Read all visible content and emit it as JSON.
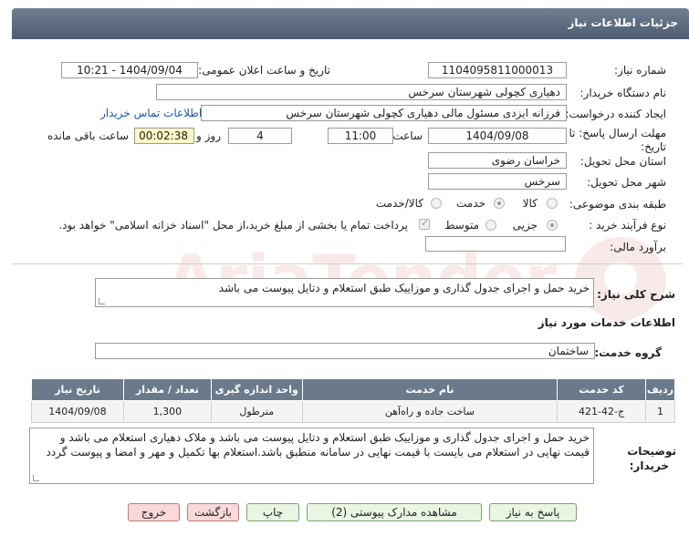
{
  "header": {
    "title": "جزئیات اطلاعات نیاز"
  },
  "fields": {
    "need_number_label": "شماره نیاز:",
    "need_number": "1104095811000013",
    "announce_label": "تاریخ و ساعت اعلان عمومی:",
    "announce_value": "1404/09/04 - 10:21",
    "buyer_label": "نام دستگاه خریدار:",
    "buyer_value": "دهیاری کچولی شهرستان سرخس",
    "creator_label": "ایجاد کننده درخواست:",
    "creator_value": "فرزانه ایزدی مسئول مالی دهیاری کچولی شهرستان سرخس",
    "contact_link": "اطلاعات تماس خریدار",
    "deadline_label_1": "مهلت ارسال پاسخ: تا",
    "deadline_label_2": "تاریخ:",
    "deadline_date": "1404/09/08",
    "time_label": "ساعت",
    "deadline_time": "11:00",
    "days_value": "4",
    "days_label": "روز و",
    "remaining_timer": "00:02:38",
    "remaining_label": "ساعت باقی مانده",
    "province_label": "استان محل تحویل:",
    "province_value": "خراسان رضوی",
    "city_label": "شهر محل تحویل:",
    "city_value": "سرخس",
    "category_label": "طبقه بندی موضوعی:",
    "category_options": [
      "کالا",
      "خدمت",
      "کالا/خدمت"
    ],
    "category_selected": "خدمت",
    "process_label": "نوع فرآیند خرید :",
    "process_options": [
      "جزیی",
      "متوسط"
    ],
    "process_selected": "جزیی",
    "payment_note": "پرداخت تمام یا بخشی از مبلغ خرید،از محل \"اسناد خزانه اسلامی\" خواهد بود.",
    "estimate_label": "برآورد مالی:",
    "estimate_value": ""
  },
  "description": {
    "label": "شرح کلی نیاز:",
    "value": "خرید حمل و اجرای جدول گذاری و موزاییک طبق استعلام  و دتایل پیوست می باشد"
  },
  "services": {
    "section_title": "اطلاعات خدمات مورد نیاز",
    "group_label": "گروه خدمت:",
    "group_value": "ساختمان",
    "columns": [
      "ردیف",
      "کد خدمت",
      "نام خدمت",
      "واحد اندازه گیری",
      "تعداد / مقدار",
      "تاریخ نیاز"
    ],
    "rows": [
      {
        "row": "1",
        "code": "ج-42-421",
        "name": "ساخت جاده و راه‌آهن",
        "unit": "مترطول",
        "qty": "1,300",
        "date": "1404/09/08"
      }
    ]
  },
  "buyer_notes": {
    "label_1": "توضیحات",
    "label_2": "خریدار:",
    "value": "خرید حمل و اجرای جدول گذاری و موزاییک طبق استعلام  و دتایل پیوست می باشد و ملاک دهیاری استعلام می باشد و قیمت نهایی در استعلام می بایست با قیمت نهایی در سامانه منطبق باشد.استعلام بها تکمیل و مهر و امضا و پیوست گردد"
  },
  "buttons": {
    "reply": "پاسخ به نیاز",
    "view_docs": "مشاهده مدارک پیوستی (2)",
    "print": "چاپ",
    "back": "بازگشت",
    "exit": "خروج"
  },
  "watermark_text": "AriaTender.net"
}
